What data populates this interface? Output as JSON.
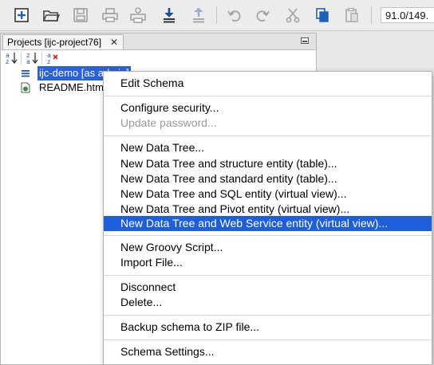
{
  "toolbar": {
    "buttons": [
      {
        "name": "new-icon"
      },
      {
        "name": "open-folder-icon"
      },
      {
        "name": "save-icon"
      },
      {
        "name": "print-icon"
      },
      {
        "name": "printer-settings-icon"
      },
      {
        "name": "import-icon"
      },
      {
        "name": "export-icon"
      },
      {
        "name": "undo-icon"
      },
      {
        "name": "redo-icon"
      },
      {
        "name": "cut-icon"
      },
      {
        "name": "copy-icon"
      },
      {
        "name": "paste-icon"
      }
    ],
    "coordinate_text": "91.0/149.",
    "accent_color": "#2a55a5"
  },
  "projects_panel": {
    "tab_label": "Projects [ijc-project76]",
    "tab_close": "✕",
    "sort_icons": [
      {
        "name": "sort-ascending-icon",
        "text": "a z ↓"
      },
      {
        "name": "sort-descending-icon",
        "text": "z a ↓"
      },
      {
        "name": "clear-sort-icon",
        "text": "a z ✕"
      }
    ],
    "tree": [
      {
        "label": "ijc-demo [as admin]",
        "icon": "schema-list-icon",
        "selected": true
      },
      {
        "label": "README.html",
        "icon": "html-file-icon",
        "selected": false
      }
    ],
    "selection_color": "#2a62d9"
  },
  "context_menu": {
    "highlight_color": "#1e5edb",
    "items": [
      {
        "label": "Edit Schema",
        "enabled": true
      },
      {
        "label": "Configure security...",
        "enabled": true
      },
      {
        "label": "Update password...",
        "enabled": false
      },
      {
        "label": "New Data Tree...",
        "enabled": true
      },
      {
        "label": "New Data Tree and structure entity (table)...",
        "enabled": true
      },
      {
        "label": "New Data Tree and standard entity (table)...",
        "enabled": true
      },
      {
        "label": "New Data Tree and SQL entity (virtual view)...",
        "enabled": true
      },
      {
        "label": "New Data Tree and Pivot entity (virtual view)...",
        "enabled": true
      },
      {
        "label": "New Data Tree and Web Service entity (virtual view)...",
        "enabled": true,
        "highlighted": true
      },
      {
        "label": "New Groovy Script...",
        "enabled": true
      },
      {
        "label": "Import File...",
        "enabled": true
      },
      {
        "label": "Disconnect",
        "enabled": true
      },
      {
        "label": "Delete...",
        "enabled": true
      },
      {
        "label": "Backup schema to ZIP file...",
        "enabled": true
      },
      {
        "label": "Schema Settings...",
        "enabled": true
      }
    ]
  }
}
